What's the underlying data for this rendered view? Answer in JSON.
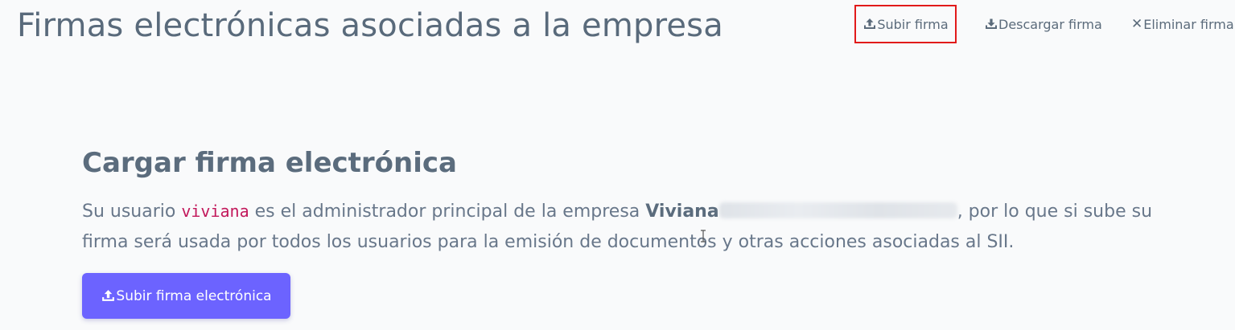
{
  "header": {
    "title": "Firmas electrónicas asociadas a la empresa",
    "actions": {
      "upload": {
        "label": "Subir firma",
        "icon": "upload-icon"
      },
      "download": {
        "label": "Descargar firma",
        "icon": "download-icon"
      },
      "delete": {
        "label": "Eliminar firma",
        "icon": "close-icon",
        "glyph": "✕"
      }
    }
  },
  "main": {
    "section_title": "Cargar firma electrónica",
    "description": {
      "before_user": "Su usuario ",
      "username": "viviana",
      "middle": " es el administrador principal de la empresa ",
      "company_visible": "Viviana",
      "after_company": ", por lo que si sube su firma será usada por todos los usuarios para la emisión de documentos y otras acciones asociadas al SII."
    },
    "upload_button": {
      "label": "Subir firma electrónica",
      "icon": "upload-icon"
    }
  },
  "colors": {
    "accent": "#6c63ff",
    "highlight_border": "#e11a1a",
    "username_code": "#c2185b",
    "text": "#5b6b7b"
  }
}
